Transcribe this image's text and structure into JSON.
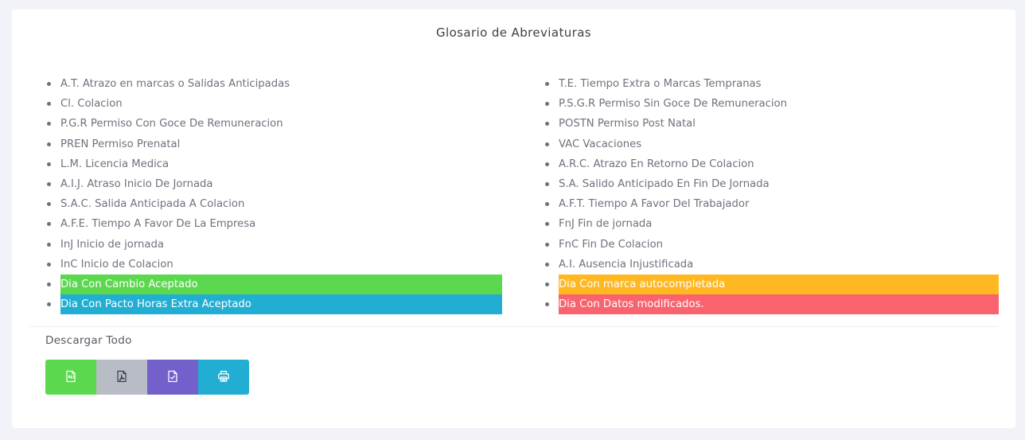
{
  "panel": {
    "title": "Glosario de Abreviaturas"
  },
  "left_items": [
    {
      "label": "A.T. Atrazo en marcas o Salidas Anticipadas"
    },
    {
      "label": "Cl. Colacion"
    },
    {
      "label": "P.G.R Permiso Con Goce De Remuneracion"
    },
    {
      "label": "PREN Permiso Prenatal"
    },
    {
      "label": "L.M. Licencia Medica"
    },
    {
      "label": "A.I.J. Atraso Inicio De Jornada"
    },
    {
      "label": "S.A.C. Salida Anticipada A Colacion"
    },
    {
      "label": "A.F.E. Tiempo A Favor De La Empresa"
    },
    {
      "label": "InJ Inicio de jornada"
    },
    {
      "label": "InC Inicio de Colacion"
    },
    {
      "label": "Dia Con Cambio Aceptado",
      "color": "#5cd84f"
    },
    {
      "label": "Dia Con Pacto Horas Extra Aceptado",
      "color": "#22aed2"
    }
  ],
  "right_items": [
    {
      "label": "T.E. Tiempo Extra o Marcas Tempranas"
    },
    {
      "label": "P.S.G.R Permiso Sin Goce De Remuneracion"
    },
    {
      "label": "POSTN Permiso Post Natal"
    },
    {
      "label": "VAC Vacaciones"
    },
    {
      "label": "A.R.C. Atrazo En Retorno De Colacion"
    },
    {
      "label": "S.A. Salido Anticipado En Fin De Jornada"
    },
    {
      "label": "A.F.T. Tiempo A Favor Del Trabajador"
    },
    {
      "label": "FnJ Fin de jornada"
    },
    {
      "label": "FnC Fin De Colacion"
    },
    {
      "label": "A.I. Ausencia Injustificada"
    },
    {
      "label": "Dia Con marca autocompletada",
      "color": "#ffb822"
    },
    {
      "label": "Dia Con Datos modificados.",
      "color": "#f8636e"
    }
  ],
  "download": {
    "label": "Descargar Todo",
    "buttons": [
      {
        "icon": "excel-file-icon",
        "color": "#5cd84f"
      },
      {
        "icon": "pdf-file-icon",
        "color": "#b8bcc4"
      },
      {
        "icon": "checked-file-icon",
        "color": "#7460cb"
      },
      {
        "icon": "print-icon",
        "color": "#22aed2"
      }
    ]
  }
}
